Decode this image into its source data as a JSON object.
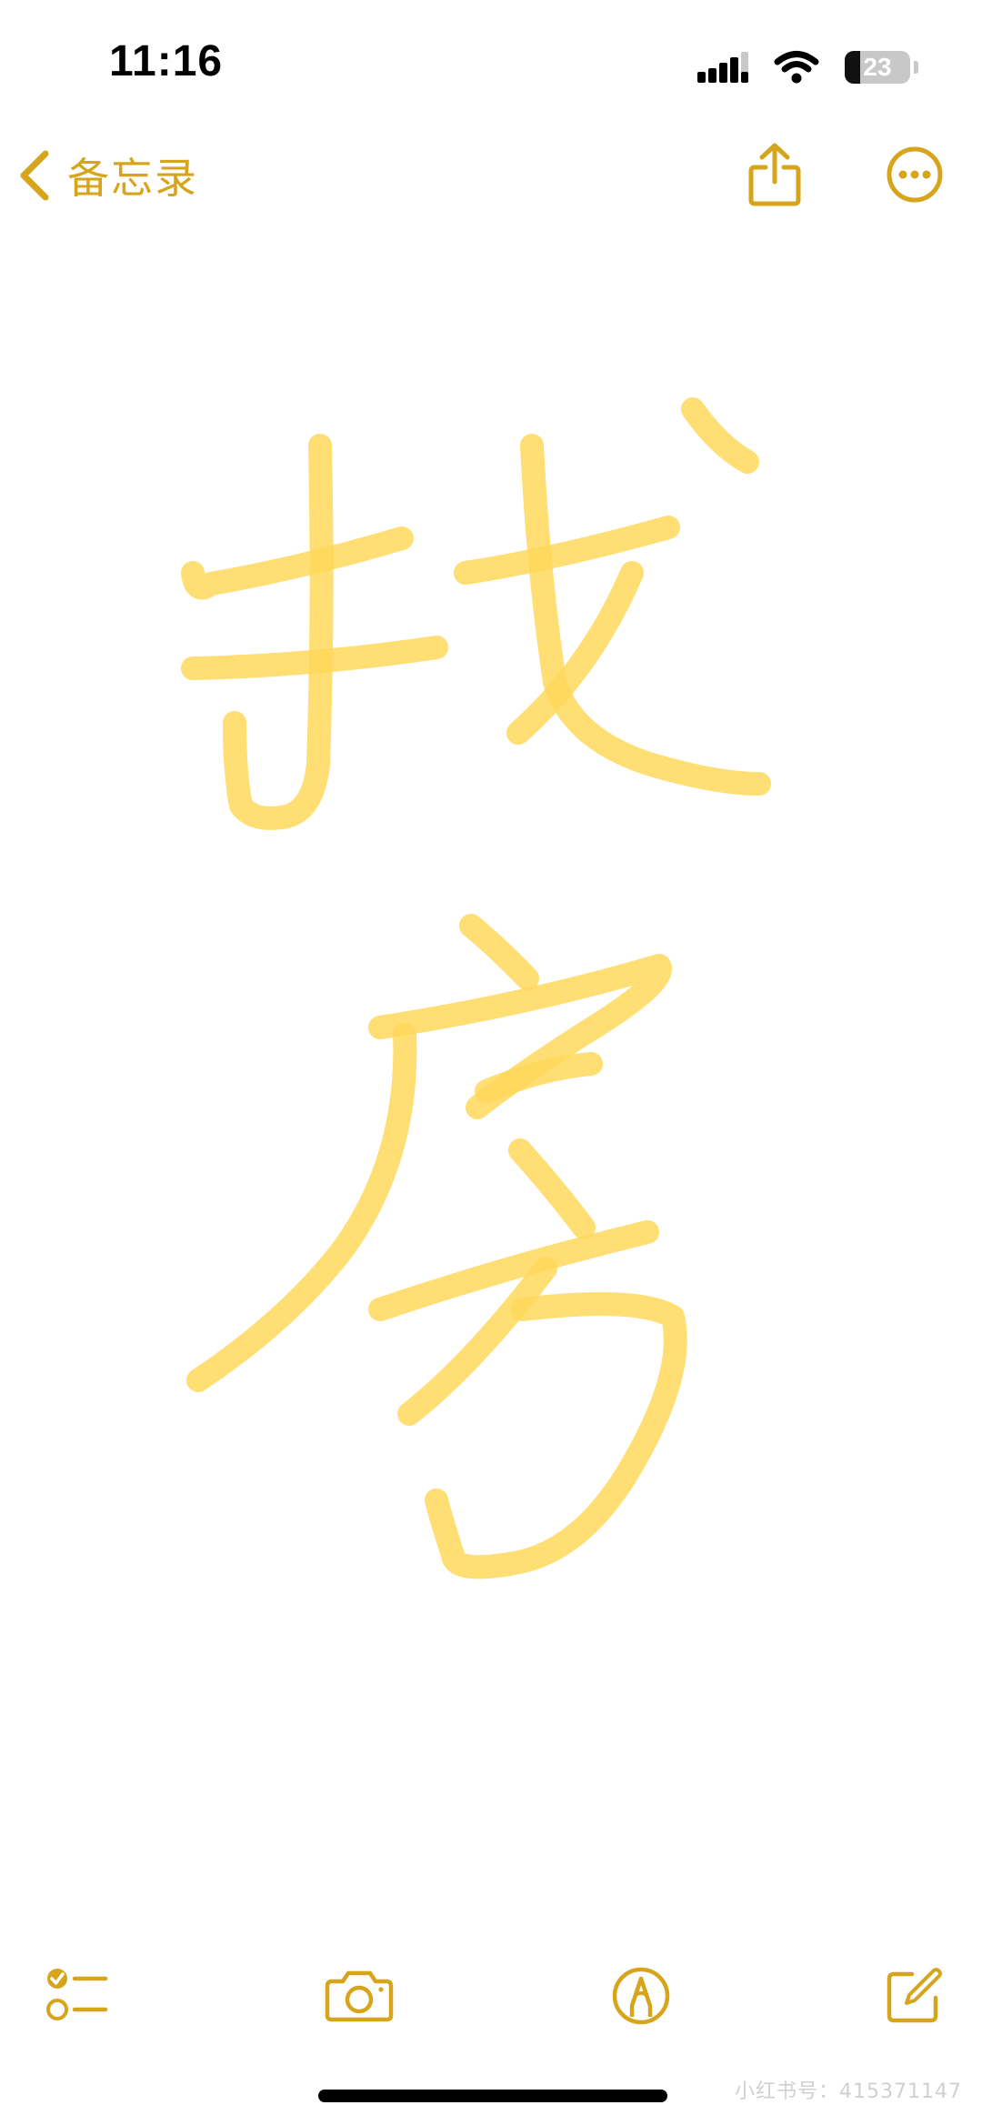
{
  "status_bar": {
    "time": "11:16",
    "battery_level": "23",
    "battery_fraction": 0.23,
    "icons": [
      "cellular-signal-icon",
      "wifi-icon",
      "battery-icon"
    ]
  },
  "nav": {
    "back_label": "备忘录",
    "icons": [
      "chevron-left-icon",
      "share-icon",
      "more-icon"
    ]
  },
  "toolbar": {
    "icons": [
      "checklist-icon",
      "camera-icon",
      "markup-icon",
      "compose-icon"
    ]
  },
  "watermark": {
    "text": "小红书号：415371147"
  },
  "colors": {
    "accent": "#d6a51c",
    "ink": "#ffd85a",
    "background": "#ffffff"
  }
}
